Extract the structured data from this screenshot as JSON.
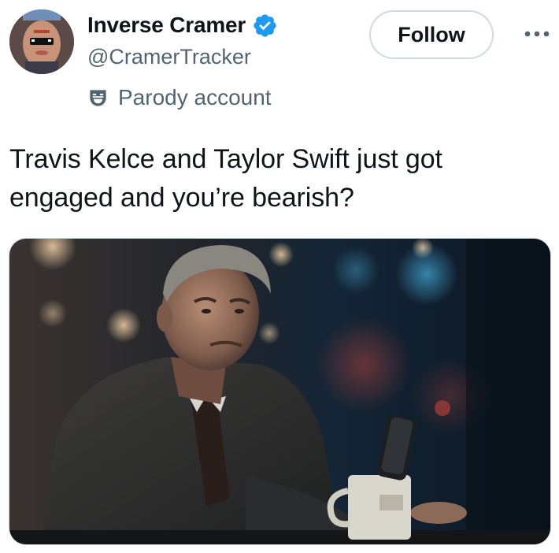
{
  "author": {
    "display_name": "Inverse Cramer",
    "handle": "@CramerTracker",
    "verified_icon": "verified-badge-icon",
    "verified_color": "#1d9bf0",
    "label": "Parody account",
    "label_icon": "parody-mask-icon"
  },
  "actions": {
    "follow_label": "Follow",
    "more_icon": "more-horizontal-icon"
  },
  "tweet": {
    "text": "Travis Kelce and Taylor Swift just got engaged and you’re bearish?"
  },
  "media": {
    "type": "image",
    "subject": "man-at-bar-photo"
  },
  "colors": {
    "text_primary": "#0f1419",
    "text_secondary": "#536471",
    "border": "#cfd9de"
  }
}
